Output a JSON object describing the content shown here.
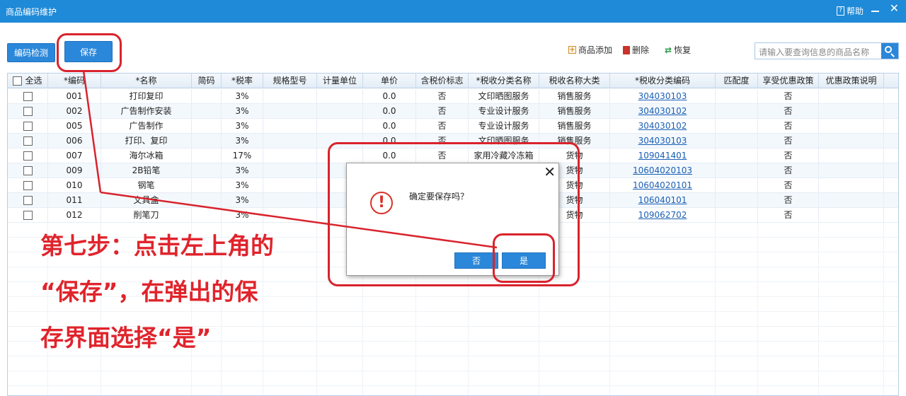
{
  "window": {
    "title": "商品编码维护",
    "help_label": "帮助",
    "help_icon": "document-help-icon",
    "close_glyph": "✕"
  },
  "toolbar": {
    "check_label": "编码检测",
    "save_label": "保存",
    "add_label": "商品添加",
    "delete_label": "删除",
    "restore_label": "恢复",
    "search_placeholder": "请输入要查询信息的商品名称"
  },
  "table": {
    "select_all_label": "全选",
    "headers": [
      "*编码",
      "*名称",
      "简码",
      "*税率",
      "规格型号",
      "计量单位",
      "单价",
      "含税价标志",
      "*税收分类名称",
      "税收名称大类",
      "*税收分类编码",
      "匹配度",
      "享受优惠政策",
      "优惠政策说明"
    ],
    "rows": [
      {
        "code": "001",
        "name": "打印复印",
        "rate": "3%",
        "price": "0.0",
        "tax_incl": "否",
        "cat_name": "文印晒图服务",
        "big_cat": "销售服务",
        "cat_code": "304030103",
        "pref": "否"
      },
      {
        "code": "002",
        "name": "广告制作安装",
        "rate": "3%",
        "price": "0.0",
        "tax_incl": "否",
        "cat_name": "专业设计服务",
        "big_cat": "销售服务",
        "cat_code": "304030102",
        "pref": "否"
      },
      {
        "code": "005",
        "name": "广告制作",
        "rate": "3%",
        "price": "0.0",
        "tax_incl": "否",
        "cat_name": "专业设计服务",
        "big_cat": "销售服务",
        "cat_code": "304030102",
        "pref": "否"
      },
      {
        "code": "006",
        "name": "打印、复印",
        "rate": "3%",
        "price": "0.0",
        "tax_incl": "否",
        "cat_name": "文印晒图服务",
        "big_cat": "销售服务",
        "cat_code": "304030103",
        "pref": "否"
      },
      {
        "code": "007",
        "name": "海尔冰箱",
        "rate": "17%",
        "price": "0.0",
        "tax_incl": "否",
        "cat_name": "家用冷藏冷冻箱",
        "big_cat": "货物",
        "cat_code": "109041401",
        "pref": "否"
      },
      {
        "code": "009",
        "name": "2B铅笔",
        "rate": "3%",
        "price": "",
        "tax_incl": "",
        "cat_name": "",
        "big_cat": "货物",
        "cat_code": "10604020103",
        "pref": "否"
      },
      {
        "code": "010",
        "name": "钢笔",
        "rate": "3%",
        "price": "",
        "tax_incl": "",
        "cat_name": "",
        "big_cat": "货物",
        "cat_code": "10604020101",
        "pref": "否"
      },
      {
        "code": "011",
        "name": "文具盒",
        "rate": "3%",
        "price": "",
        "tax_incl": "",
        "cat_name": "",
        "big_cat": "货物",
        "cat_code": "106040101",
        "pref": "否"
      },
      {
        "code": "012",
        "name": "削笔刀",
        "rate": "3%",
        "price": "",
        "tax_incl": "",
        "cat_name": "",
        "big_cat": "货物",
        "cat_code": "109062702",
        "pref": "否"
      }
    ]
  },
  "dialog": {
    "message": "确定要保存吗？",
    "no_label": "否",
    "yes_label": "是",
    "close_glyph": "✕",
    "warn_glyph": "!"
  },
  "annotation": {
    "line1": "第七步：点击左上角的",
    "line2": "“保存”，在弹出的保",
    "line3": "存界面选择“是”",
    "color": "#e0242c"
  },
  "colors": {
    "titlebar": "#1e8ad8",
    "button": "#2b87d9",
    "link": "#1a5fb4"
  }
}
